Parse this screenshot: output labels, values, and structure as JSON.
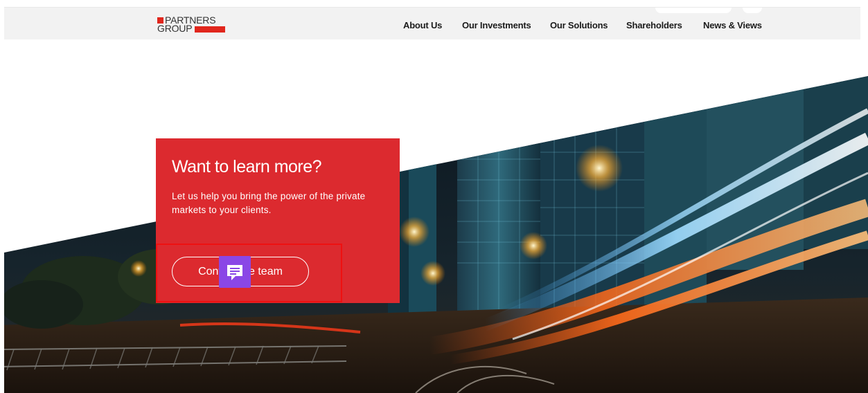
{
  "header": {
    "logo": {
      "line1": "PARTNERS",
      "line2": "GROUP"
    },
    "nav": [
      {
        "label": "About Us"
      },
      {
        "label": "Our Investments"
      },
      {
        "label": "Our Solutions"
      },
      {
        "label": "Shareholders"
      },
      {
        "label": "News & Views"
      }
    ]
  },
  "hero": {
    "image": "city-night-light-trails"
  },
  "cta": {
    "title": "Want to learn more?",
    "body": "Let us help you bring the power of the private markets to your clients.",
    "button_label": "Contact the team"
  },
  "chat_widget": {
    "icon": "chat-bubble-icon"
  },
  "colors": {
    "brand_red": "#dc2a2f",
    "logo_red": "#e1261c",
    "header_bg": "#f2f2f2",
    "highlight": "#ee1111",
    "chat_purple": "#8a47e6"
  }
}
